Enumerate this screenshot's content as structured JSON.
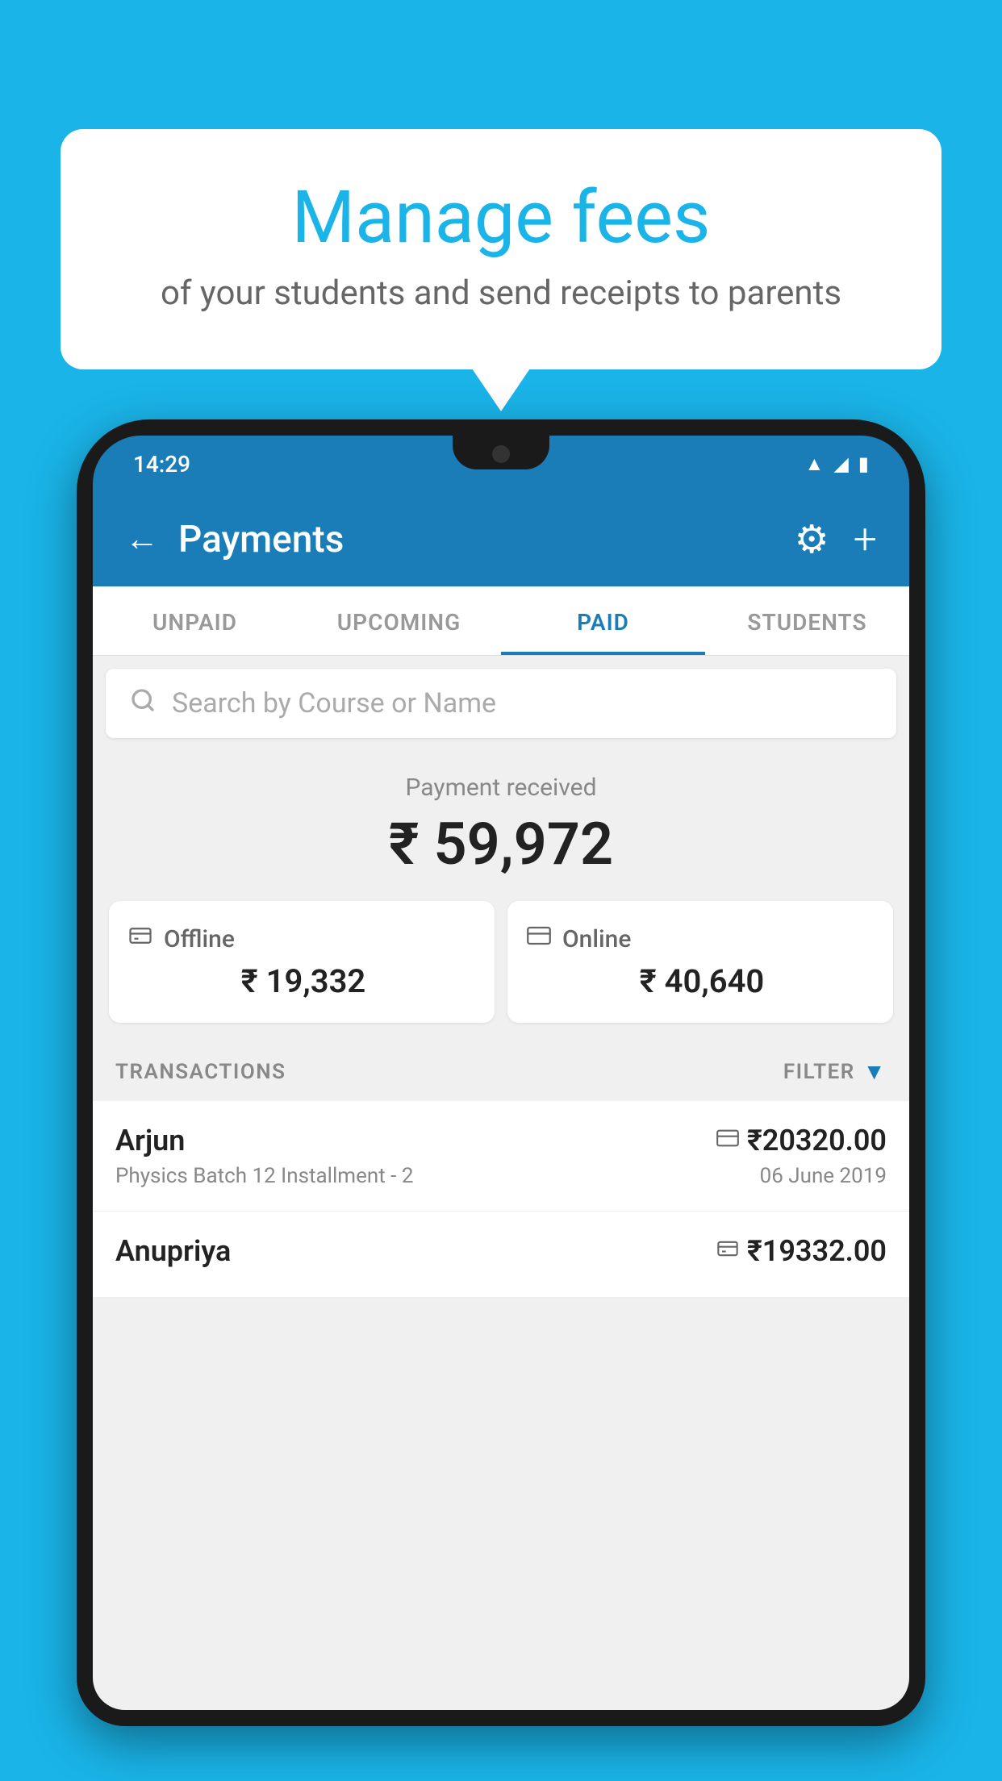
{
  "page": {
    "background_color": "#1ab4e8"
  },
  "speech_bubble": {
    "title": "Manage fees",
    "subtitle": "of your students and send receipts to parents"
  },
  "phone": {
    "status_bar": {
      "time": "14:29"
    },
    "header": {
      "title": "Payments",
      "back_label": "←",
      "gear_label": "⚙",
      "plus_label": "+"
    },
    "tabs": [
      {
        "label": "UNPAID",
        "active": false
      },
      {
        "label": "UPCOMING",
        "active": false
      },
      {
        "label": "PAID",
        "active": true
      },
      {
        "label": "STUDENTS",
        "active": false
      }
    ],
    "search": {
      "placeholder": "Search by Course or Name"
    },
    "payment_received": {
      "label": "Payment received",
      "amount": "₹ 59,972",
      "offline_label": "Offline",
      "offline_amount": "₹ 19,332",
      "online_label": "Online",
      "online_amount": "₹ 40,640"
    },
    "transactions": {
      "header_label": "TRANSACTIONS",
      "filter_label": "FILTER",
      "rows": [
        {
          "name": "Arjun",
          "description": "Physics Batch 12 Installment - 2",
          "amount": "₹20320.00",
          "date": "06 June 2019",
          "type": "online"
        },
        {
          "name": "Anupriya",
          "description": "",
          "amount": "₹19332.00",
          "date": "",
          "type": "offline"
        }
      ]
    }
  }
}
